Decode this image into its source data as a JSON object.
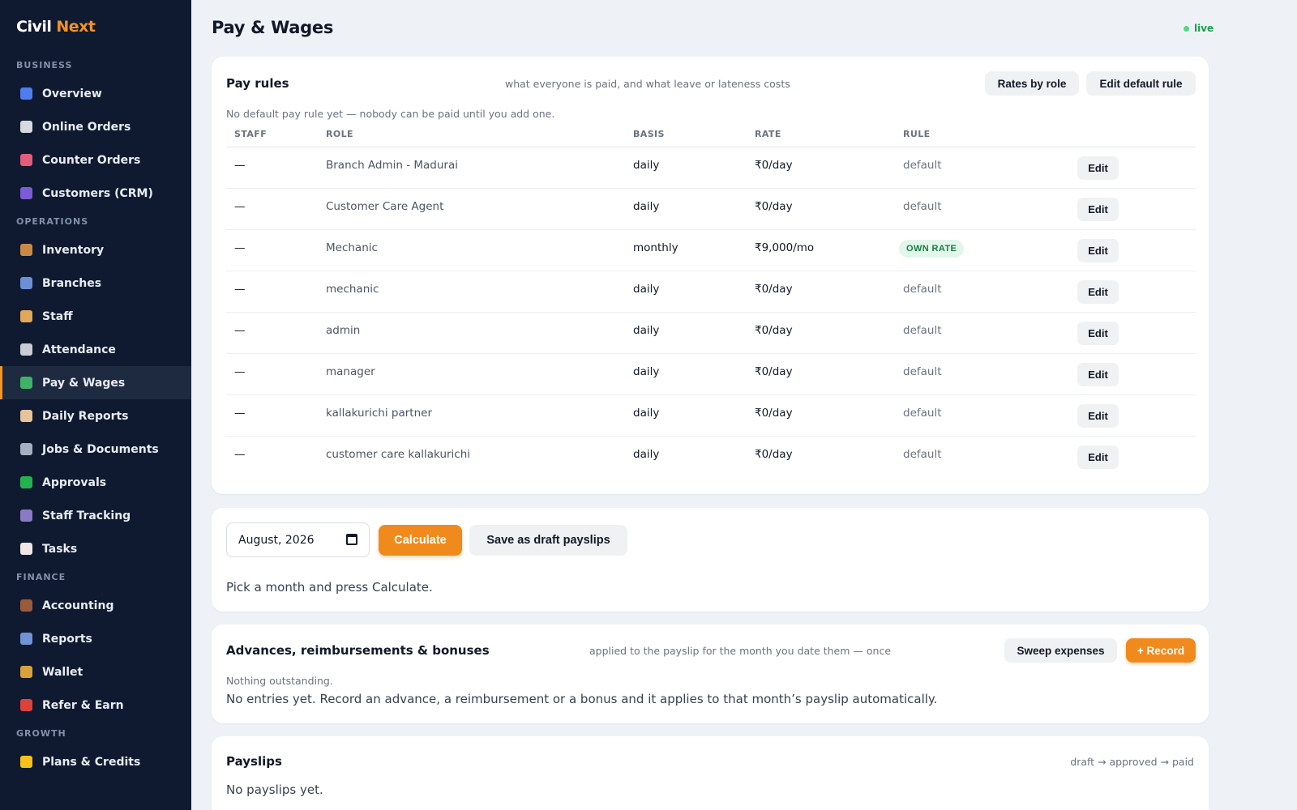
{
  "brand": {
    "part1": "Civil",
    "part2": "Next"
  },
  "sidebar": {
    "sections": [
      {
        "label": "BUSINESS",
        "items": [
          {
            "label": "Overview",
            "icon": "chart-icon",
            "color": "#4f7df0"
          },
          {
            "label": "Online Orders",
            "icon": "receipt-icon",
            "color": "#d6d9e0"
          },
          {
            "label": "Counter Orders",
            "icon": "store-icon",
            "color": "#e35c7a"
          },
          {
            "label": "Customers (CRM)",
            "icon": "users-icon",
            "color": "#7b5cd6"
          }
        ]
      },
      {
        "label": "OPERATIONS",
        "items": [
          {
            "label": "Inventory",
            "icon": "box-icon",
            "color": "#c98a45"
          },
          {
            "label": "Branches",
            "icon": "building-icon",
            "color": "#6c8fd8"
          },
          {
            "label": "Staff",
            "icon": "person-icon",
            "color": "#e0a85a"
          },
          {
            "label": "Attendance",
            "icon": "clock-icon",
            "color": "#c9ccd3"
          },
          {
            "label": "Pay & Wages",
            "icon": "money-icon",
            "color": "#3fb26a",
            "active": true
          },
          {
            "label": "Daily Reports",
            "icon": "memo-icon",
            "color": "#e6c39a"
          },
          {
            "label": "Jobs & Documents",
            "icon": "wrench-icon",
            "color": "#a7b0c0"
          },
          {
            "label": "Approvals",
            "icon": "check-icon",
            "color": "#22b34f"
          },
          {
            "label": "Staff Tracking",
            "icon": "satellite-icon",
            "color": "#8a7bc4"
          },
          {
            "label": "Tasks",
            "icon": "list-icon",
            "color": "#f0e6e6"
          }
        ]
      },
      {
        "label": "FINANCE",
        "items": [
          {
            "label": "Accounting",
            "icon": "briefcase-icon",
            "color": "#9a5a3c"
          },
          {
            "label": "Reports",
            "icon": "trend-icon",
            "color": "#6f93d6"
          },
          {
            "label": "Wallet",
            "icon": "moneybag-icon",
            "color": "#d9a23a"
          },
          {
            "label": "Refer & Earn",
            "icon": "gift-icon",
            "color": "#e0403a"
          }
        ]
      },
      {
        "label": "GROWTH",
        "items": [
          {
            "label": "Plans & Credits",
            "icon": "star-icon",
            "color": "#f6c21a"
          }
        ]
      }
    ]
  },
  "header": {
    "title": "Pay & Wages",
    "status": "live"
  },
  "pay_rules": {
    "title": "Pay rules",
    "subtitle": "what everyone is paid, and what leave or lateness costs",
    "rates_button": "Rates by role",
    "edit_default_button": "Edit default rule",
    "notice": "No default pay rule yet — nobody can be paid until you add one.",
    "columns": {
      "staff": "STAFF",
      "role": "ROLE",
      "basis": "BASIS",
      "rate": "RATE",
      "rule": "RULE"
    },
    "edit_label": "Edit",
    "rows": [
      {
        "staff": "—",
        "role": "Branch Admin - Madurai",
        "basis": "daily",
        "rate": "₹0/day",
        "rule": "default",
        "badge": false
      },
      {
        "staff": "—",
        "role": "Customer Care Agent",
        "basis": "daily",
        "rate": "₹0/day",
        "rule": "default",
        "badge": false
      },
      {
        "staff": "—",
        "role": "Mechanic",
        "basis": "monthly",
        "rate": "₹9,000/mo",
        "rule": "OWN RATE",
        "badge": true
      },
      {
        "staff": "—",
        "role": "mechanic",
        "basis": "daily",
        "rate": "₹0/day",
        "rule": "default",
        "badge": false
      },
      {
        "staff": "—",
        "role": "admin",
        "basis": "daily",
        "rate": "₹0/day",
        "rule": "default",
        "badge": false
      },
      {
        "staff": "—",
        "role": "manager",
        "basis": "daily",
        "rate": "₹0/day",
        "rule": "default",
        "badge": false
      },
      {
        "staff": "—",
        "role": "kallakurichi partner",
        "basis": "daily",
        "rate": "₹0/day",
        "rule": "default",
        "badge": false
      },
      {
        "staff": "—",
        "role": "customer care kallakurichi",
        "basis": "daily",
        "rate": "₹0/day",
        "rule": "default",
        "badge": false
      }
    ]
  },
  "calculate": {
    "month_value": "August, 2026",
    "calculate_button": "Calculate",
    "save_draft_button": "Save as draft payslips",
    "hint": "Pick a month and press Calculate."
  },
  "advances": {
    "title": "Advances, reimbursements & bonuses",
    "subtitle": "applied to the payslip for the month you date them — once",
    "sweep_button": "Sweep expenses",
    "record_button": "+ Record",
    "status": "Nothing outstanding.",
    "empty_text": "No entries yet. Record an advance, a reimbursement or a bonus and it applies to that month’s payslip automatically."
  },
  "payslips": {
    "title": "Payslips",
    "flow": "draft → approved → paid",
    "empty_text": "No payslips yet."
  },
  "colors": {
    "accent": "#f18a1c",
    "sidebar_bg": "#0f1a30",
    "live": "#16a34a"
  }
}
